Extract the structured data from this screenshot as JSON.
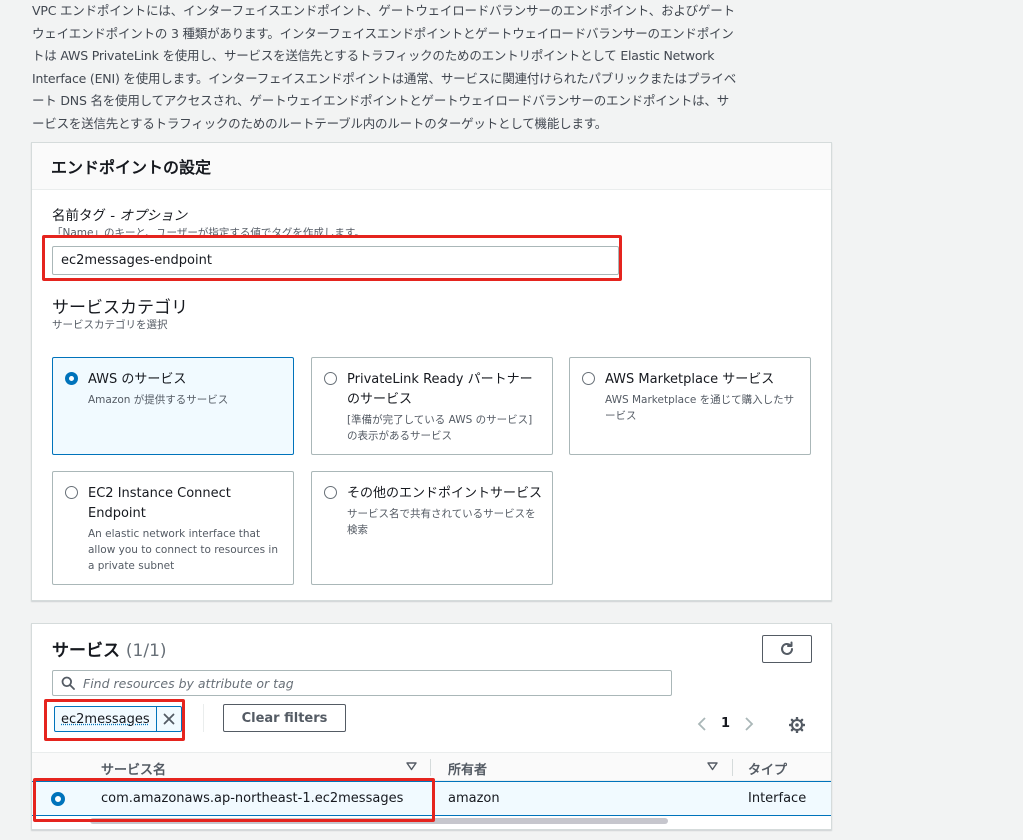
{
  "intro": {
    "lines": [
      "VPC エンドポイントには、インターフェイスエンドポイント、ゲートウェイロードバランサーのエンドポイント、およびゲート",
      "ウェイエンドポイントの 3 種類があります。インターフェイスエンドポイントとゲートウェイロードバランサーのエンドポイン",
      "トは AWS PrivateLink を使用し、サービスを送信先とするトラフィックのためのエントリポイントとして Elastic Network",
      "Interface (ENI) を使用します。インターフェイスエンドポイントは通常、サービスに関連付けられたパブリックまたはプライベ",
      "ート DNS 名を使用してアクセスされ、ゲートウェイエンドポイントとゲートウェイロードバランサーのエンドポイントは、サ",
      "ービスを送信先とするトラフィックのためのルートテーブル内のルートのターゲットとして機能します。"
    ]
  },
  "settings": {
    "title": "エンドポイントの設定",
    "name_tag_label": "名前タグ - ",
    "name_tag_optional": "オプション",
    "name_tag_help": "「Name」のキーと、ユーザーが指定する値でタグを作成します。",
    "name_tag_value": "ec2messages-endpoint",
    "service_category_title": "サービスカテゴリ",
    "service_category_help": "サービスカテゴリを選択",
    "tiles": [
      {
        "title": "AWS のサービス",
        "desc": "Amazon が提供するサービス",
        "selected": true
      },
      {
        "title": "PrivateLink Ready パートナーのサービス",
        "desc": "[準備が完了している AWS のサービス] の表示があるサービス",
        "selected": false
      },
      {
        "title": "AWS Marketplace サービス",
        "desc": "AWS Marketplace を通じて購入したサービス",
        "selected": false
      },
      {
        "title": "EC2 Instance Connect Endpoint",
        "desc": "An elastic network interface that allow you to connect to resources in a private subnet",
        "selected": false
      },
      {
        "title": "その他のエンドポイントサービス",
        "desc": "サービス名で共有されているサービスを検索",
        "selected": false
      }
    ]
  },
  "services": {
    "title": "サービス",
    "count": "(1/1)",
    "search_placeholder": "Find resources by attribute or tag",
    "filter_token": "ec2messages",
    "clear_filters": "Clear filters",
    "page": "1",
    "columns": {
      "name": "サービス名",
      "owner": "所有者",
      "type": "タイプ"
    },
    "rows": [
      {
        "name": "com.amazonaws.ap-northeast-1.ec2messages",
        "owner": "amazon",
        "type": "Interface",
        "selected": true
      }
    ]
  },
  "colors": {
    "accent": "#0073bb",
    "highlight": "#e5241e",
    "selected_bg": "#f1faff"
  }
}
